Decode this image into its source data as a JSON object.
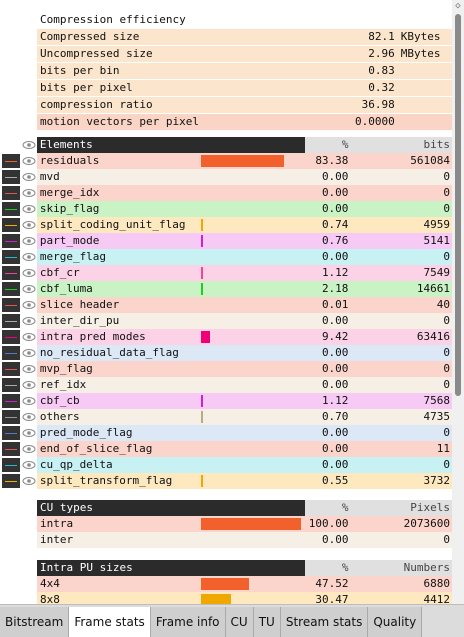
{
  "compression": {
    "title": "Compression efficiency",
    "rows": [
      {
        "label": "Compressed size",
        "value": "82.1",
        "unit": "KBytes",
        "bg": "#fbe5cc"
      },
      {
        "label": "Uncompressed size",
        "value": "2.96",
        "unit": "MBytes",
        "bg": "#fbe5cc"
      },
      {
        "label": "bits per bin",
        "value": "0.83",
        "unit": "",
        "bg": "#fbe5cc"
      },
      {
        "label": "bits per pixel",
        "value": "0.32",
        "unit": "",
        "bg": "#fbe5cc"
      },
      {
        "label": "compression ratio",
        "value": "36.98",
        "unit": "",
        "bg": "#fbe5cc"
      },
      {
        "label": "motion vectors per pixel",
        "value": "0.0000",
        "unit": "",
        "bg": "#fad4c4"
      }
    ]
  },
  "elements": {
    "header": {
      "name": "Elements",
      "pct": "%",
      "bits": "bits"
    },
    "rows": [
      {
        "name": "residuals",
        "pct": "83.38",
        "bits": "561084",
        "bg": "#fbd5cb",
        "bar": "#f2612b",
        "frac": 0.8338,
        "line": "#f2612b",
        "eye": true
      },
      {
        "name": "mvd",
        "pct": "0.00",
        "bits": "0",
        "bg": "#f6efe6",
        "bar": "",
        "frac": 0,
        "line": "#aaaaaa",
        "eye": true
      },
      {
        "name": "merge_idx",
        "pct": "0.00",
        "bits": "0",
        "bg": "#fbd5cb",
        "bar": "",
        "frac": 0,
        "line": "#dd5555",
        "eye": true
      },
      {
        "name": "skip_flag",
        "pct": "0.00",
        "bits": "0",
        "bg": "#c9f3c5",
        "bar": "",
        "frac": 0,
        "line": "#22cc22",
        "eye": true
      },
      {
        "name": "split_coding_unit_flag",
        "pct": "0.74",
        "bits": "4959",
        "bg": "#fde8c0",
        "bar": "#f0a800",
        "frac": 0.0074,
        "line": "#f0b000",
        "eye": true
      },
      {
        "name": "part_mode",
        "pct": "0.76",
        "bits": "5141",
        "bg": "#f7c9f5",
        "bar": "#cc22cc",
        "frac": 0.0076,
        "line": "#cc22cc",
        "eye": true
      },
      {
        "name": "merge_flag",
        "pct": "0.00",
        "bits": "0",
        "bg": "#c8f1f4",
        "bar": "",
        "frac": 0,
        "line": "#22bbcc",
        "eye": true
      },
      {
        "name": "cbf_cr",
        "pct": "1.12",
        "bits": "7549",
        "bg": "#fcd2e6",
        "bar": "#ee4499",
        "frac": 0.0112,
        "line": "#ee4499",
        "eye": true
      },
      {
        "name": "cbf_luma",
        "pct": "2.18",
        "bits": "14661",
        "bg": "#c9f3c5",
        "bar": "#22cc22",
        "frac": 0.0218,
        "line": "#22cc22",
        "eye": true
      },
      {
        "name": "slice header",
        "pct": "0.01",
        "bits": "40",
        "bg": "#fbd5cb",
        "bar": "",
        "frac": 0,
        "line": "#dd5555",
        "eye": true
      },
      {
        "name": "inter_dir_pu",
        "pct": "0.00",
        "bits": "0",
        "bg": "#f6efe6",
        "bar": "",
        "frac": 0,
        "line": "#aaaaaa",
        "eye": true
      },
      {
        "name": "intra pred modes",
        "pct": "9.42",
        "bits": "63416",
        "bg": "#fcd2e6",
        "bar": "#ee0077",
        "frac": 0.0942,
        "line": "#ee0077",
        "eye": true
      },
      {
        "name": "no_residual_data_flag",
        "pct": "0.00",
        "bits": "0",
        "bg": "#dde8f7",
        "bar": "",
        "frac": 0,
        "line": "#5577cc",
        "eye": true
      },
      {
        "name": "mvp_flag",
        "pct": "0.00",
        "bits": "0",
        "bg": "#fbd5cb",
        "bar": "",
        "frac": 0,
        "line": "#dd5555",
        "eye": true
      },
      {
        "name": "ref_idx",
        "pct": "0.00",
        "bits": "0",
        "bg": "#f6efe6",
        "bar": "",
        "frac": 0,
        "line": "#aaaaaa",
        "eye": true
      },
      {
        "name": "cbf_cb",
        "pct": "1.12",
        "bits": "7568",
        "bg": "#f7c9f5",
        "bar": "#cc22cc",
        "frac": 0.0112,
        "line": "#cc22cc",
        "eye": true
      },
      {
        "name": "others",
        "pct": "0.70",
        "bits": "4735",
        "bg": "#f6efe6",
        "bar": "#bbaa88",
        "frac": 0.007,
        "line": "#999999",
        "eye": true
      },
      {
        "name": "pred_mode_flag",
        "pct": "0.00",
        "bits": "0",
        "bg": "#dde8f7",
        "bar": "",
        "frac": 0,
        "line": "#5577cc",
        "eye": true
      },
      {
        "name": "end_of_slice_flag",
        "pct": "0.00",
        "bits": "11",
        "bg": "#fbd5cb",
        "bar": "",
        "frac": 0,
        "line": "#dd5555",
        "eye": true
      },
      {
        "name": "cu_qp_delta",
        "pct": "0.00",
        "bits": "0",
        "bg": "#c8f1f4",
        "bar": "",
        "frac": 0,
        "line": "#22bbcc",
        "eye": true
      },
      {
        "name": "split_transform_flag",
        "pct": "0.55",
        "bits": "3732",
        "bg": "#fde8c0",
        "bar": "#f0a800",
        "frac": 0.0055,
        "line": "#f0b000",
        "eye": true
      }
    ]
  },
  "cu_types": {
    "header": {
      "name": "CU types",
      "pct": "%",
      "bits": "Pixels"
    },
    "rows": [
      {
        "name": "intra",
        "pct": "100.00",
        "bits": "2073600",
        "bg": "#fbd5cb",
        "bar": "#f2612b",
        "frac": 1.0
      },
      {
        "name": "inter",
        "pct": "0.00",
        "bits": "0",
        "bg": "#f6efe6",
        "bar": "",
        "frac": 0
      }
    ]
  },
  "intra_pu": {
    "header": {
      "name": "Intra PU sizes",
      "pct": "%",
      "bits": "Numbers"
    },
    "rows": [
      {
        "name": "4x4",
        "pct": "47.52",
        "bits": "6880",
        "bg": "#fbd5cb",
        "bar": "#f2612b",
        "frac": 0.4752
      },
      {
        "name": "8x8",
        "pct": "30.47",
        "bits": "4412",
        "bg": "#fde8c0",
        "bar": "#f0a800",
        "frac": 0.3047
      }
    ]
  },
  "tabs": [
    {
      "label": "Bitstream",
      "active": false
    },
    {
      "label": "Frame stats",
      "active": true
    },
    {
      "label": "Frame info",
      "active": false
    },
    {
      "label": "CU",
      "active": false
    },
    {
      "label": "TU",
      "active": false
    },
    {
      "label": "Stream stats",
      "active": false
    },
    {
      "label": "Quality",
      "active": false
    }
  ],
  "scroll_up_glyph": "◇"
}
